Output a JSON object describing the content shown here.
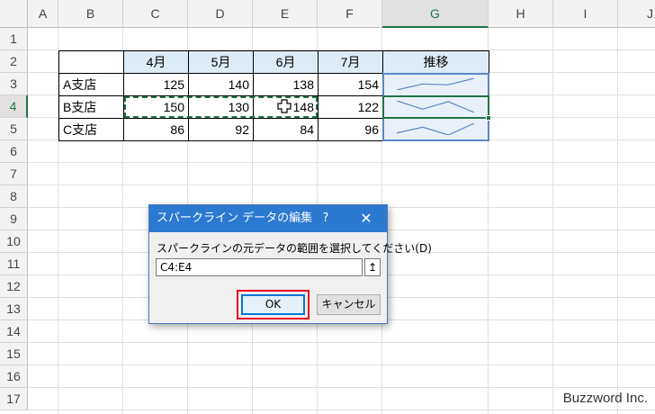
{
  "sheet": {
    "columns": [
      "A",
      "B",
      "C",
      "D",
      "E",
      "F",
      "G",
      "H",
      "I",
      "J"
    ],
    "rows": [
      "1",
      "2",
      "3",
      "4",
      "5",
      "6",
      "7",
      "8",
      "9",
      "10",
      "11",
      "12",
      "13",
      "14",
      "15",
      "16",
      "17"
    ],
    "selected_column": "G",
    "selected_row": "4"
  },
  "table": {
    "month_headers": [
      "4月",
      "5月",
      "6月",
      "7月"
    ],
    "trend_header": "推移",
    "branches": [
      {
        "name": "A支店",
        "values": [
          "125",
          "140",
          "138",
          "154"
        ]
      },
      {
        "name": "B支店",
        "values": [
          "150",
          "130",
          "148",
          "122"
        ]
      },
      {
        "name": "C支店",
        "values": [
          "86",
          "92",
          "84",
          "96"
        ]
      }
    ]
  },
  "sparklines": [
    {
      "row": "3",
      "values": [
        125,
        140,
        138,
        154
      ]
    },
    {
      "row": "4",
      "values": [
        150,
        130,
        148,
        122
      ]
    },
    {
      "row": "5",
      "values": [
        86,
        92,
        84,
        96
      ]
    }
  ],
  "colors": {
    "header_fill": "#ddebf7",
    "sparkline": "#5b86c5",
    "selection": "#217346",
    "title_bar": "#2b79d0",
    "highlight": "#e8081f"
  },
  "dialog": {
    "title": "スパークライン データの編集",
    "help": "?",
    "close": "✕",
    "prompt": "スパークラインの元データの範囲を選択してください(D)",
    "input_value": "C4:E4",
    "collapse_icon": "↥",
    "ok_label": "OK",
    "cancel_label": "キャンセル"
  },
  "watermark": "Buzzword Inc."
}
